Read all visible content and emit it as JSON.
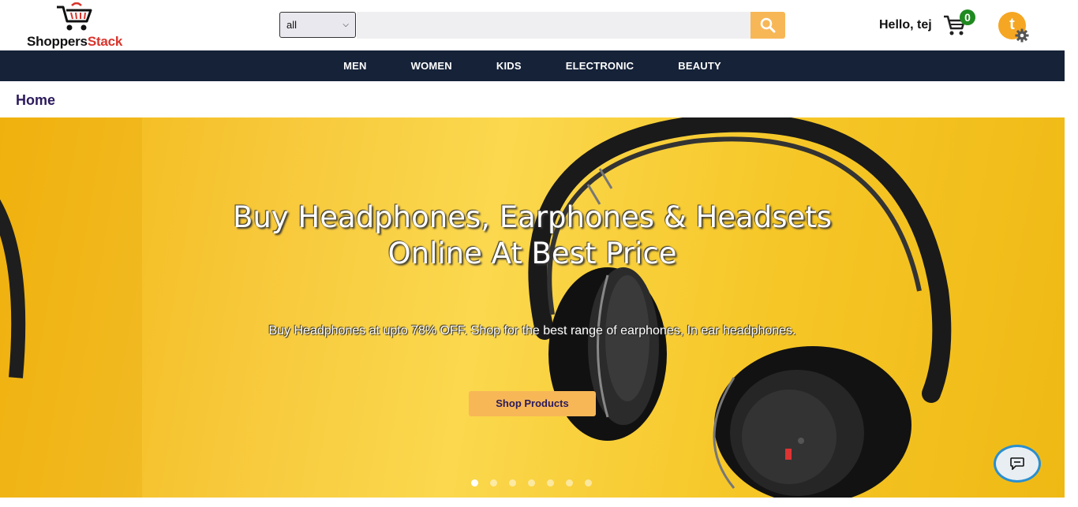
{
  "header": {
    "logo": {
      "part1": "Shoppers",
      "part2": "Stack",
      "icon": "cart-logo-icon"
    },
    "category_select": {
      "value": "all",
      "icon": "chevron-down-icon"
    },
    "search": {
      "placeholder": "",
      "icon": "search-icon"
    },
    "greeting": "Hello, tej",
    "cart": {
      "icon": "cart-icon",
      "count": "0"
    },
    "avatar": {
      "initial": "t",
      "icon": "gear-icon"
    }
  },
  "nav": {
    "items": [
      {
        "label": "MEN"
      },
      {
        "label": "WOMEN"
      },
      {
        "label": "KIDS"
      },
      {
        "label": "ELECTRONIC"
      },
      {
        "label": "BEAUTY"
      }
    ]
  },
  "breadcrumb": {
    "label": "Home"
  },
  "hero": {
    "title_line1": "Buy Headphones, Earphones & Headsets",
    "title_line2": "Online At Best Price",
    "subtitle": "Buy Headphones at upto 78% OFF. Shop for the best range of earphones, In ear headphones.",
    "button_label": "Shop Products",
    "slides": 7,
    "active_slide": 1
  },
  "chat": {
    "icon": "chat-icon"
  },
  "colors": {
    "nav_bg": "#152238",
    "accent": "#f7b757",
    "hero_bg": "#f7c83a",
    "badge": "#1f8a1f",
    "avatar": "#f5a623",
    "brand_red": "#d9342b"
  }
}
